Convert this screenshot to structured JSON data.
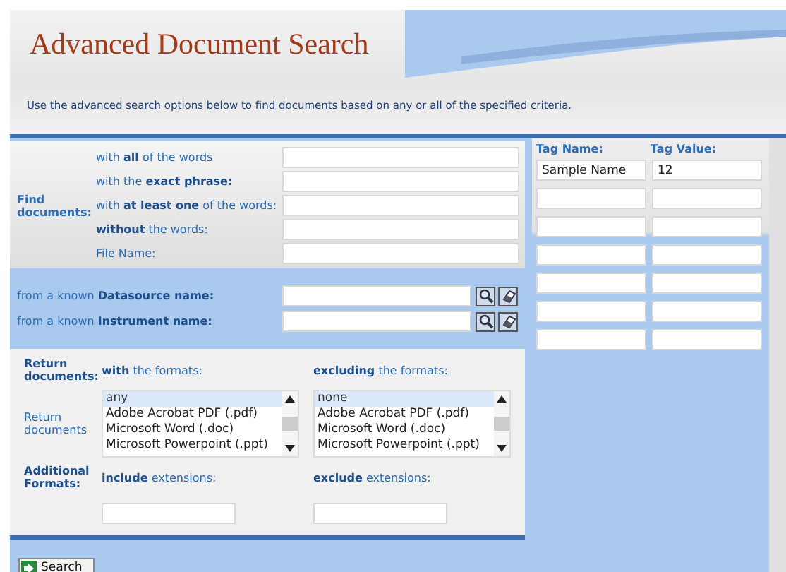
{
  "title": "Advanced Document Search",
  "description": "Use the advanced search options below to find documents based on any or all of the specified criteria.",
  "find": {
    "heading": "Find documents:",
    "rows": [
      {
        "label": "with **all** of the words"
      },
      {
        "label": "with the **exact phrase:**"
      },
      {
        "label": "with **at least one** of the words:"
      },
      {
        "label": "**without** the words:"
      },
      {
        "label": "File Name:"
      }
    ]
  },
  "known": [
    {
      "label": "from a known **Datasource name:**"
    },
    {
      "label": "from a known **Instrument name:**"
    }
  ],
  "formats": {
    "heading": "Return documents:",
    "side_label": "Return documents",
    "with_label": "**with** the formats:",
    "excluding_label": "**excluding** the formats:",
    "with_options": [
      {
        "text": "any",
        "selected": true
      },
      {
        "text": "Adobe Acrobat PDF (.pdf)",
        "selected": false
      },
      {
        "text": "Microsoft Word (.doc)",
        "selected": false
      },
      {
        "text": "Microsoft Powerpoint (.ppt)",
        "selected": false
      }
    ],
    "excluding_options": [
      {
        "text": "none",
        "selected": true
      },
      {
        "text": "Adobe Acrobat PDF (.pdf)",
        "selected": false
      },
      {
        "text": "Microsoft Word (.doc)",
        "selected": false
      },
      {
        "text": "Microsoft Powerpoint (.ppt)",
        "selected": false
      }
    ]
  },
  "additional": {
    "heading": "Additional Formats:",
    "include_label": "**include** extensions:",
    "exclude_label": "**exclude** extensions:"
  },
  "tags": {
    "columns": [
      "Tag Name:",
      "Tag Value:"
    ],
    "rows": [
      {
        "name": "Sample Name",
        "value": "12"
      },
      {},
      {},
      {},
      {},
      {},
      {}
    ]
  },
  "search_button": "Search"
}
